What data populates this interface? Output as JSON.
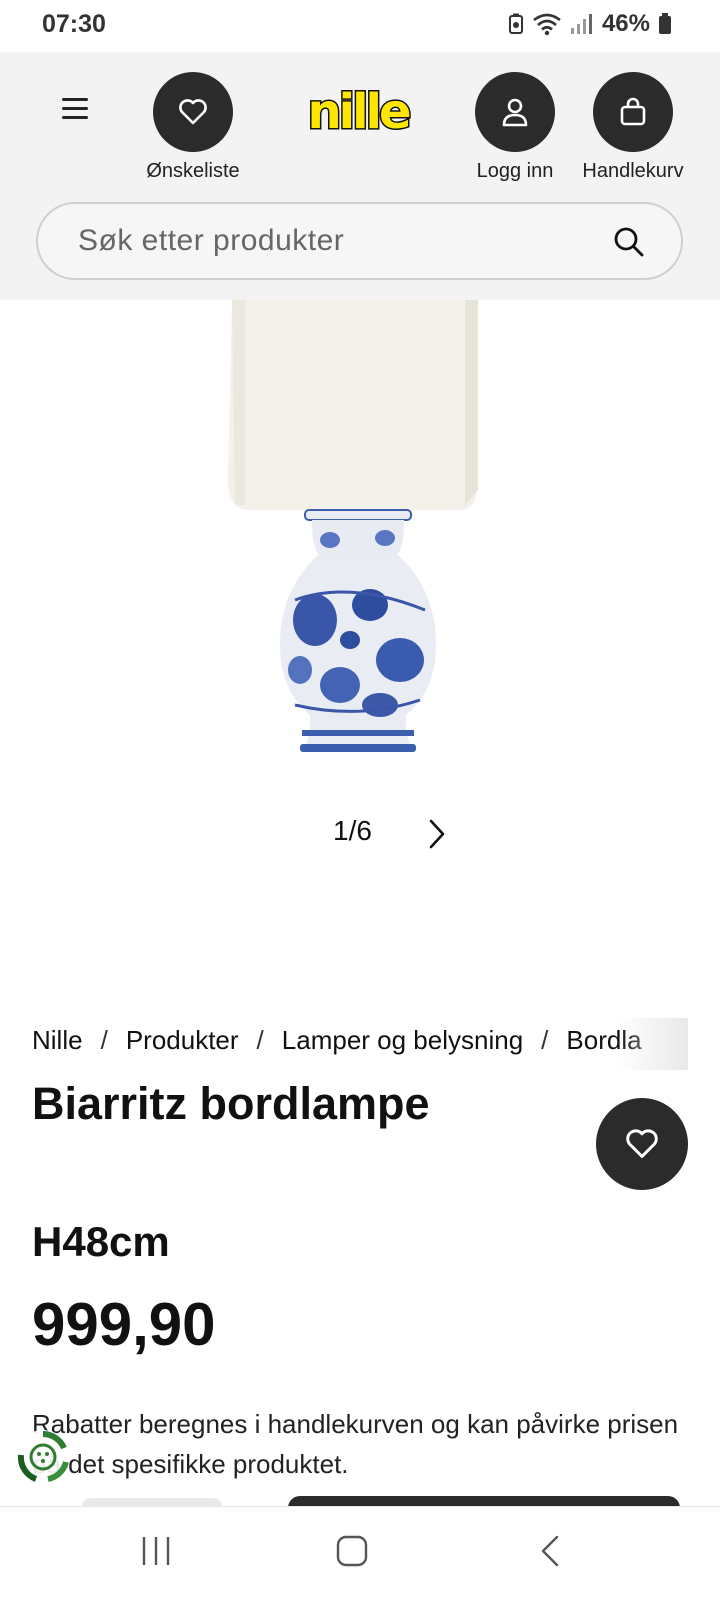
{
  "status_bar": {
    "time": "07:30",
    "battery": "46%",
    "icons": [
      "battery-saver-icon",
      "wifi-icon",
      "signal-icon",
      "battery-icon"
    ]
  },
  "header": {
    "logo_text": "nille",
    "wishlist_label": "Ønskeliste",
    "login_label": "Logg inn",
    "cart_label": "Handlekurv",
    "search_placeholder": "Søk etter produkter"
  },
  "gallery": {
    "pager": "1/6"
  },
  "breadcrumb": {
    "items": [
      "Nille",
      "Produkter",
      "Lamper og belysning",
      "Bordla"
    ]
  },
  "product": {
    "title": "Biarritz bordlampe",
    "variant": "H48cm",
    "price": "999,90",
    "discount_note": "Rabatter beregnes i handlekurven og kan påvirke prisen på det spesifikke produktet."
  },
  "colors": {
    "brand_yellow": "#FFE600",
    "dark_button": "#2B2B2B",
    "header_bg": "#F3F3F3"
  }
}
